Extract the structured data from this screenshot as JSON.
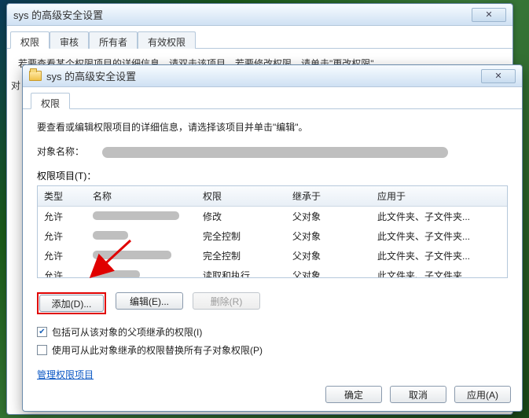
{
  "bg": {
    "title": "sys 的高级安全设置",
    "tabs": [
      "权限",
      "审核",
      "所有者",
      "有效权限"
    ],
    "truncated_line": "若要查看某个权限项目的详细信息，请双击该项目。若要修改权限，请单击\"更改权限\"。",
    "left_char": "对"
  },
  "fg": {
    "title": "sys 的高级安全设置",
    "tab": "权限",
    "intro": "要查看或编辑权限项目的详细信息，请选择该项目并单击\"编辑\"。",
    "object_label": "对象名称：",
    "perm_title": "权限项目(T)：",
    "headers": {
      "type": "类型",
      "name": "名称",
      "perm": "权限",
      "inh": "继承于",
      "app": "应用于"
    },
    "rows": [
      {
        "type": "允许",
        "name_w": 110,
        "perm": "修改",
        "inh": "父对象",
        "app": "此文件夹、子文件夹..."
      },
      {
        "type": "允许",
        "name_w": 45,
        "perm": "完全控制",
        "inh": "父对象",
        "app": "此文件夹、子文件夹..."
      },
      {
        "type": "允许",
        "name_w": 100,
        "perm": "完全控制",
        "inh": "父对象",
        "app": "此文件夹、子文件夹..."
      },
      {
        "type": "允许",
        "name_w": 60,
        "perm": "读取和执行",
        "inh": "父对象",
        "app": "此文件夹、子文件夹..."
      }
    ],
    "buttons": {
      "add": "添加(D)...",
      "edit": "编辑(E)...",
      "delete": "删除(R)"
    },
    "chk1": {
      "checked": true,
      "label": "包括可从该对象的父项继承的权限(I)"
    },
    "chk2": {
      "checked": false,
      "label": "使用可从此对象继承的权限替换所有子对象权限(P)"
    },
    "link": "管理权限项目",
    "footer": {
      "ok": "确定",
      "cancel": "取消",
      "apply": "应用(A)"
    }
  }
}
